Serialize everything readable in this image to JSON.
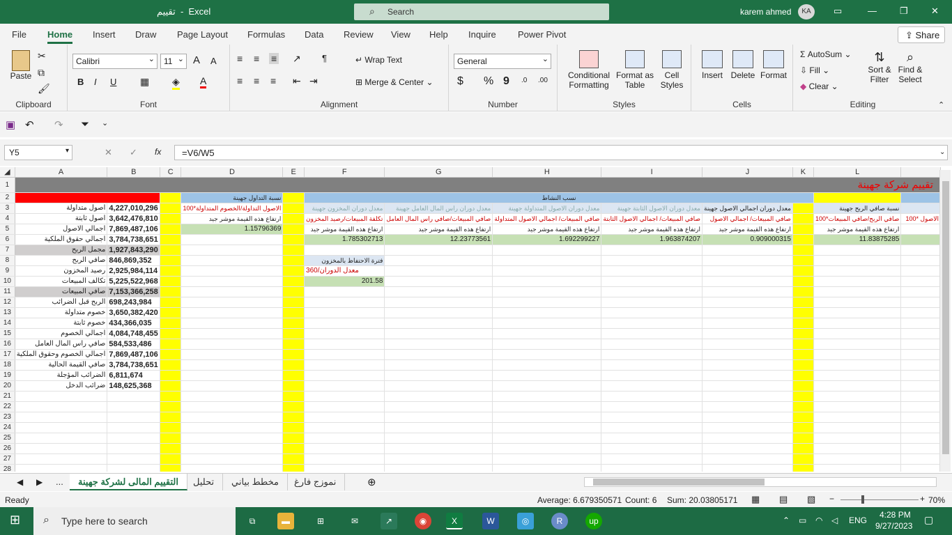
{
  "titlebar": {
    "doc": "تقييم",
    "sep": "-",
    "app": "Excel",
    "search": "Search",
    "user": "karem ahmed",
    "initials": "KA"
  },
  "menu": [
    "File",
    "Home",
    "Insert",
    "Draw",
    "Page Layout",
    "Formulas",
    "Data",
    "Review",
    "View",
    "Help",
    "Inquire",
    "Power Pivot"
  ],
  "share": "Share",
  "ribbon": {
    "clipboard": {
      "paste": "Paste",
      "label": "Clipboard"
    },
    "font": {
      "name": "Calibri",
      "size": "11",
      "bold": "B",
      "italic": "I",
      "underline": "U",
      "grow": "A",
      "shrink": "A",
      "label": "Font"
    },
    "alignment": {
      "wrap": "Wrap Text",
      "merge": "Merge & Center",
      "label": "Alignment"
    },
    "number": {
      "format": "General",
      "currency": "$",
      "percent": "%",
      "comma": "9",
      "label": "Number"
    },
    "styles": {
      "conditional": "Conditional",
      "conditional2": "Formatting",
      "format_table": "Format as",
      "format_table2": "Table",
      "cell_styles": "Cell",
      "cell_styles2": "Styles",
      "label": "Styles"
    },
    "cells": {
      "insert": "Insert",
      "delete": "Delete",
      "format": "Format",
      "label": "Cells"
    },
    "editing": {
      "autosum": "AutoSum",
      "fill": "Fill",
      "clear": "Clear",
      "sort": "Sort &",
      "sort2": "Filter",
      "find": "Find &",
      "find2": "Select",
      "label": "Editing"
    }
  },
  "namebox": "Y5",
  "formula": "=V6/W5",
  "fx": "fx",
  "columns": [
    "A",
    "B",
    "C",
    "D",
    "E",
    "F",
    "G",
    "H",
    "I",
    "J",
    "K",
    "L",
    ""
  ],
  "title_cell": "تقييم شركة جهينة",
  "rows": [
    [
      "اصول متداولة",
      "4,227,010,296"
    ],
    [
      "اصول ثابتة",
      "3,642,476,810"
    ],
    [
      "اجمالي الاصول",
      "7,869,487,106"
    ],
    [
      "اجمالي حقوق الملكية",
      "3,784,738,651"
    ],
    [
      "مجمل الربح",
      "1,927,843,290"
    ],
    [
      "صافي الربح",
      "846,869,352"
    ],
    [
      "رصيد المخزون",
      "2,925,984,114"
    ],
    [
      "تكالف المبيعات",
      "5,225,522,968"
    ],
    [
      "صافي المبيعات",
      "7,153,366,258"
    ],
    [
      "الربح قبل الضرائب",
      "698,243,984"
    ],
    [
      "خصوم متداولة",
      "3,650,382,420"
    ],
    [
      "خصوم ثابتة",
      "434,366,035"
    ],
    [
      "اجمالي الخصوم",
      "4,084,748,455"
    ],
    [
      "صافي راس المال العامل",
      "584,533,486"
    ],
    [
      "اجمالي الخصوم وحقوق الملكية",
      "7,869,487,106"
    ],
    [
      "صافي القيمة الحالية",
      "3,784,738,651"
    ],
    [
      "الضرائب المؤجلة",
      "6,811,674"
    ],
    [
      "ضرائب الدخل",
      "148,625,368"
    ]
  ],
  "ratios": {
    "d_title": "نسبة التداول جهينة",
    "d_formula": "الاصول التداولة/الخصوم المتداولة*100",
    "d_note": "ارتفاع هذه القيمة موشر جيد",
    "d_value": "1.15796369",
    "activity_title": "نسب النشاط",
    "f_title": "معدل دوران المخزون جهينة",
    "f_formula": "تكلفة المبيعات/رصيد المخزون",
    "f_value": "1.785302713",
    "g_title": "معدل دوران راس المال العامل جهينة",
    "g_formula": "صافي المبيعات/صافي راس المال العامل",
    "g_value": "12.23773561",
    "h_title": "معدل دوران الاصول المتداولة جهينة",
    "h_formula": "صافي المبيعات/ اجمالي الاصول المتداولة",
    "h_value": "1.692299227",
    "i_title": "معدل دوران الاصول الثابتة جهينة",
    "i_formula": "صافي المبيعات/ اجمالي الاصول الثابتة",
    "i_value": "1.963874207",
    "j_title": "معدل دوران اجمالي الاصول جهينة",
    "j_formula": "صافي المبيعات/ اجمالي الاصول",
    "j_value": "0.909000315",
    "l_title": "نسبة صافي الربح جهينة",
    "l_formula": "صافي الربح/صافي المبيعات*100",
    "l_value": "11.83875285",
    "m_formula": "الاصول *100",
    "note": "ارتفاع هذه القيمة موشر جيد",
    "hold_title": "فترة الاحتفاظ بالمخزون",
    "hold_formula": "360/معدل الدوران",
    "hold_value": "201.58"
  },
  "sheets": [
    "...",
    "التقييم المالى لشركة جهينة",
    "تحليل",
    "مخطط بياني",
    "نموزج فارغ"
  ],
  "status": {
    "ready": "Ready",
    "average": "Average: 6.679350571",
    "count": "Count: 6",
    "sum": "Sum: 20.03805171",
    "zoom": "70%"
  },
  "taskbar": {
    "search": "Type here to search",
    "time": "4:28 PM",
    "date": "9/27/2023",
    "lang": "ENG"
  }
}
